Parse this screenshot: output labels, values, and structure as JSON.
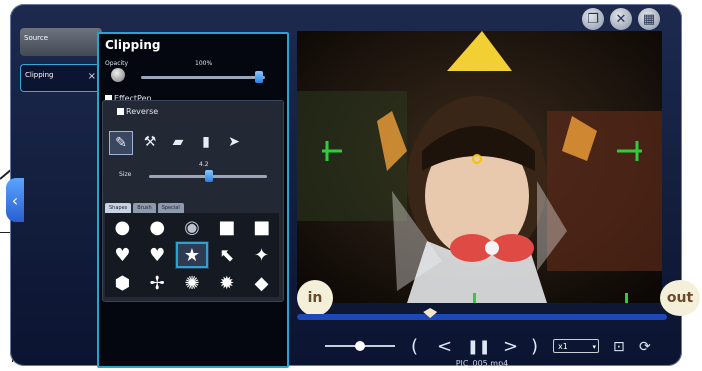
{
  "tabs": [
    {
      "label": "Source"
    },
    {
      "label": "Clipping",
      "close": "×"
    }
  ],
  "panel": {
    "title": "Clipping",
    "opacity_label": "Opacity",
    "opacity_value": "100%",
    "effect_label": "EffectPen",
    "reverse_label": "Reverse",
    "size_label": "Size",
    "size_value": "4.2",
    "subtabs": [
      "Shapes",
      "Brush",
      "Special"
    ]
  },
  "tools": [
    "pen-icon",
    "stamp-icon",
    "eraser-icon",
    "bucket-icon",
    "cursor-icon"
  ],
  "shapes": [
    "circle-icon",
    "circle-icon",
    "glow-circle-icon",
    "square-icon",
    "square-icon",
    "heart-icon",
    "heart-icon",
    "star-icon",
    "arrow-icon",
    "sparkle-icon",
    "hexagon-icon",
    "pinwheel-icon",
    "badge-icon",
    "burst-icon",
    "diamond-icon"
  ],
  "selected_shape_index": 7,
  "player": {
    "in_label": "in",
    "out_label": "out",
    "speed": "x1",
    "filename": "PIC_005.mp4",
    "volume": 0.5,
    "timeline_position": 0.36
  },
  "top_icons": [
    "copy-icon",
    "close-icon",
    "grid-icon"
  ],
  "colors": {
    "accent": "#2aa3d3",
    "timeline": "#1c48b9",
    "panel_bg": "#04070f"
  }
}
